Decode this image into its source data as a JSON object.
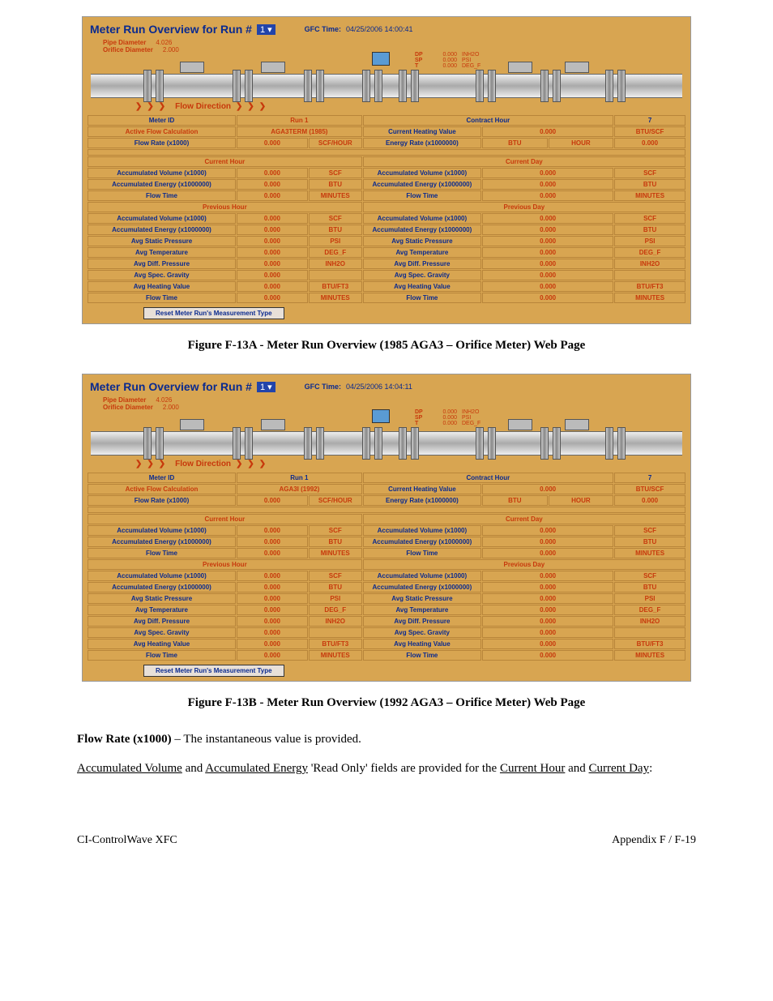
{
  "figA": {
    "panelTitle": "Meter Run Overview for Run #",
    "runSel": "1 ▾",
    "gfcLabel": "GFC Time:",
    "gfcValue": "04/25/2006 14:00:41",
    "pipeDiamLabel": "Pipe Diameter",
    "pipeDiamVal": "4.026",
    "orifDiamLabel": "Orifice Diameter",
    "orifDiamVal": "2.000",
    "dp": {
      "l": "DP",
      "v": "0.000",
      "u": "INH2O"
    },
    "sp": {
      "l": "SP",
      "v": "0.000",
      "u": "PSI"
    },
    "t": {
      "l": "T",
      "v": "0.000",
      "u": "DEG_F"
    },
    "flowDir": "Flow Direction",
    "info": {
      "meterIdLabel": "Meter ID",
      "meterIdVal": "Run 1",
      "contractHourLabel": "Contract Hour",
      "contractHourVal": "7",
      "activeFlowLabel": "Active Flow Calculation",
      "activeFlowVal": "AGA3TERM (1985)",
      "chvLabel": "Current Heating Value",
      "chvVal": "0.000",
      "chvUnit": "BTU/SCF",
      "flowRateLabel": "Flow Rate (x1000)",
      "flowRateVal": "0.000",
      "flowRateUnit": "SCF/HOUR",
      "energyRateLabel": "Energy Rate (x1000000)",
      "energyRateUnit1": "BTU",
      "energyRateUnit2": "HOUR",
      "energyRateVal": "0.000"
    },
    "sectCH": "Current Hour",
    "sectCD": "Current Day",
    "sectPH": "Previous Hour",
    "sectPD": "Previous Day",
    "rows": {
      "accVol": {
        "l": "Accumulated Volume (x1000)",
        "v": "0.000",
        "u": "SCF"
      },
      "accEng": {
        "l": "Accumulated Energy (x1000000)",
        "v": "0.000",
        "u": "BTU"
      },
      "flowT": {
        "l": "Flow Time",
        "v": "0.000",
        "u": "MINUTES"
      },
      "statP": {
        "l": "Avg Static Pressure",
        "v": "0.000",
        "u": "PSI"
      },
      "temp": {
        "l": "Avg Temperature",
        "v": "0.000",
        "u": "DEG_F"
      },
      "diffP": {
        "l": "Avg Diff. Pressure",
        "v": "0.000",
        "u": "INH2O"
      },
      "specG": {
        "l": "Avg Spec. Gravity",
        "v": "0.000",
        "u": ""
      },
      "heatV": {
        "l": "Avg Heating Value",
        "v": "0.000",
        "u": "BTU/FT3"
      }
    },
    "resetBtn": "Reset Meter Run's Measurement Type",
    "caption": "Figure F-13A - Meter Run Overview (1985 AGA3 – Orifice Meter) Web Page"
  },
  "figB": {
    "panelTitle": "Meter Run Overview for Run #",
    "runSel": "1 ▾",
    "gfcLabel": "GFC Time:",
    "gfcValue": "04/25/2006 14:04:11",
    "pipeDiamLabel": "Pipe Diameter",
    "pipeDiamVal": "4.026",
    "orifDiamLabel": "Orifice Diameter",
    "orifDiamVal": "2.000",
    "dp": {
      "l": "DP",
      "v": "0.000",
      "u": "INH2O"
    },
    "sp": {
      "l": "SP",
      "v": "0.000",
      "u": "PSI"
    },
    "t": {
      "l": "T",
      "v": "0.000",
      "u": "DEG_F"
    },
    "flowDir": "Flow Direction",
    "info": {
      "meterIdLabel": "Meter ID",
      "meterIdVal": "Run 1",
      "contractHourLabel": "Contract Hour",
      "contractHourVal": "7",
      "activeFlowLabel": "Active Flow Calculation",
      "activeFlowVal": "AGA3I (1992)",
      "chvLabel": "Current Heating Value",
      "chvVal": "0.000",
      "chvUnit": "BTU/SCF",
      "flowRateLabel": "Flow Rate (x1000)",
      "flowRateVal": "0.000",
      "flowRateUnit": "SCF/HOUR",
      "energyRateLabel": "Energy Rate (x1000000)",
      "energyRateUnit1": "BTU",
      "energyRateUnit2": "HOUR",
      "energyRateVal": "0.000"
    },
    "sectCH": "Current Hour",
    "sectCD": "Current Day",
    "sectPH": "Previous Hour",
    "sectPD": "Previous Day",
    "rows": {
      "accVol": {
        "l": "Accumulated Volume (x1000)",
        "v": "0.000",
        "u": "SCF"
      },
      "accEng": {
        "l": "Accumulated Energy (x1000000)",
        "v": "0.000",
        "u": "BTU"
      },
      "flowT": {
        "l": "Flow Time",
        "v": "0.000",
        "u": "MINUTES"
      },
      "statP": {
        "l": "Avg Static Pressure",
        "v": "0.000",
        "u": "PSI"
      },
      "temp": {
        "l": "Avg Temperature",
        "v": "0.000",
        "u": "DEG_F"
      },
      "diffP": {
        "l": "Avg Diff. Pressure",
        "v": "0.000",
        "u": "INH2O"
      },
      "specG": {
        "l": "Avg Spec. Gravity",
        "v": "0.000",
        "u": ""
      },
      "heatV": {
        "l": "Avg Heating Value",
        "v": "0.000",
        "u": "BTU/FT3"
      }
    },
    "resetBtn": "Reset Meter Run's Measurement Type",
    "caption": "Figure F-13B - Meter Run Overview (1992 AGA3 – Orifice Meter) Web Page"
  },
  "text": {
    "p1a": "Flow Rate (x1000)",
    "p1b": " – The instantaneous value is provided.",
    "p2a": "Accumulated Volume",
    "p2b": " and ",
    "p2c": "Accumulated Energy",
    "p2d": " 'Read Only' fields are provided for the ",
    "p2e": "Current Hour",
    "p2f": " and ",
    "p2g": "Current Day",
    "p2h": ":"
  },
  "footer": {
    "left": "CI-ControlWave XFC",
    "right": "Appendix F / F-19"
  }
}
